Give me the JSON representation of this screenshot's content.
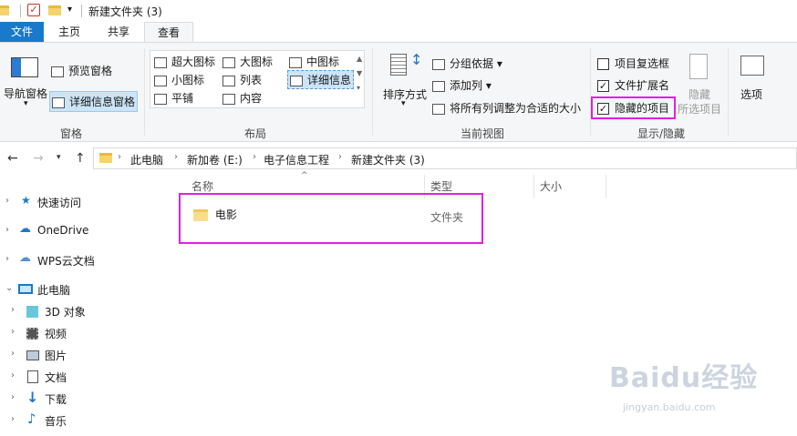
{
  "window": {
    "title": "新建文件夹 (3)",
    "qa_dropdown": "▾"
  },
  "tabs": [
    {
      "label": "文件"
    },
    {
      "label": "主页"
    },
    {
      "label": "共享"
    },
    {
      "label": "查看"
    }
  ],
  "ribbon": {
    "panes": {
      "nav_pane_label": "导航窗格",
      "preview_label": "预览窗格",
      "details_label": "详细信息窗格",
      "group": "窗格"
    },
    "layout": {
      "items": [
        "超大图标",
        "大图标",
        "中图标",
        "小图标",
        "列表",
        "详细信息",
        "平铺",
        "内容"
      ],
      "group": "布局"
    },
    "current_view": {
      "sort_label": "排序方式",
      "group_by": "分组依据",
      "add_column": "添加列",
      "fit_columns": "将所有列调整为合适的大小",
      "group": "当前视图"
    },
    "show_hide": {
      "item_checkboxes": "项目复选框",
      "file_extensions": "文件扩展名",
      "hidden_items": "隐藏的项目",
      "hide_selected_1": "隐藏",
      "hide_selected_2": "所选项目",
      "group": "显示/隐藏",
      "item_checkboxes_checked": false,
      "file_extensions_checked": true,
      "hidden_items_checked": true
    },
    "options_label": "选项"
  },
  "address": {
    "crumbs": [
      "此电脑",
      "新加卷 (E:)",
      "电子信息工程",
      "新建文件夹 (3)"
    ]
  },
  "nav": {
    "items": [
      {
        "label": "快速访问",
        "icon": "star-icon"
      },
      {
        "label": "OneDrive",
        "icon": "cloud-icon"
      },
      {
        "label": "WPS云文档",
        "icon": "cloud-outline-icon"
      },
      {
        "label": "此电脑",
        "icon": "computer-icon"
      },
      {
        "label": "3D 对象",
        "icon": "cube-icon"
      },
      {
        "label": "视频",
        "icon": "film-icon"
      },
      {
        "label": "图片",
        "icon": "picture-icon"
      },
      {
        "label": "文档",
        "icon": "document-icon"
      },
      {
        "label": "下载",
        "icon": "download-icon"
      },
      {
        "label": "音乐",
        "icon": "music-icon"
      }
    ]
  },
  "columns": {
    "name": "名称",
    "type": "类型",
    "size": "大小"
  },
  "files": [
    {
      "name": "电影",
      "type": "文件夹"
    }
  ],
  "watermark": {
    "brand": "Baidu经验",
    "url": "jingyan.baidu.com"
  },
  "colors": {
    "accent": "#1979ca",
    "highlight": "#e020e0",
    "folder": "#f8de8c"
  }
}
